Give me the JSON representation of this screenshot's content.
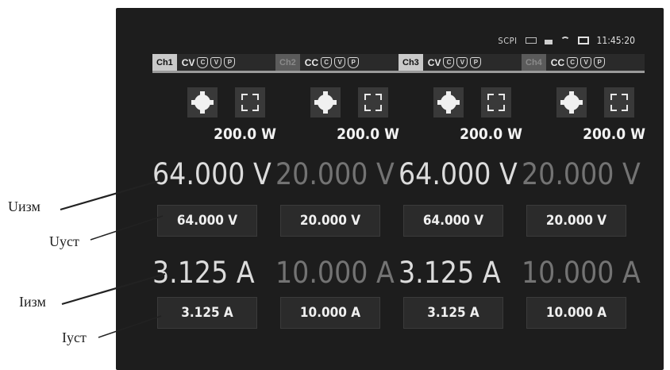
{
  "status": {
    "scpi": "SCPI",
    "time": "11:45:20"
  },
  "channels": [
    {
      "label": "Ch1",
      "mode": "CV",
      "prot": [
        "C",
        "V",
        "P"
      ],
      "power": "200.0 W",
      "v_meas": "64.000 V",
      "v_set": "64.000  V",
      "i_meas": "3.125 A",
      "i_set": "3.125   A",
      "active": true
    },
    {
      "label": "Ch2",
      "mode": "CC",
      "prot": [
        "C",
        "V",
        "P"
      ],
      "power": "200.0 W",
      "v_meas": "20.000 V",
      "v_set": "20.000  V",
      "i_meas": "10.000 A",
      "i_set": "10.000  A",
      "active": false
    },
    {
      "label": "Ch3",
      "mode": "CV",
      "prot": [
        "C",
        "V",
        "P"
      ],
      "power": "200.0 W",
      "v_meas": "64.000 V",
      "v_set": "64.000  V",
      "i_meas": "3.125 A",
      "i_set": "3.125   A",
      "active": true
    },
    {
      "label": "Ch4",
      "mode": "CC",
      "prot": [
        "C",
        "V",
        "P"
      ],
      "power": "200.0 W",
      "v_meas": "20.000 V",
      "v_set": "20.000  V",
      "i_meas": "10.000 A",
      "i_set": "10.000  A",
      "active": false
    }
  ],
  "annotations": {
    "u_meas": "Uизм",
    "u_set": "Uуст",
    "i_meas": "Iизм",
    "i_set": "Iуст"
  }
}
